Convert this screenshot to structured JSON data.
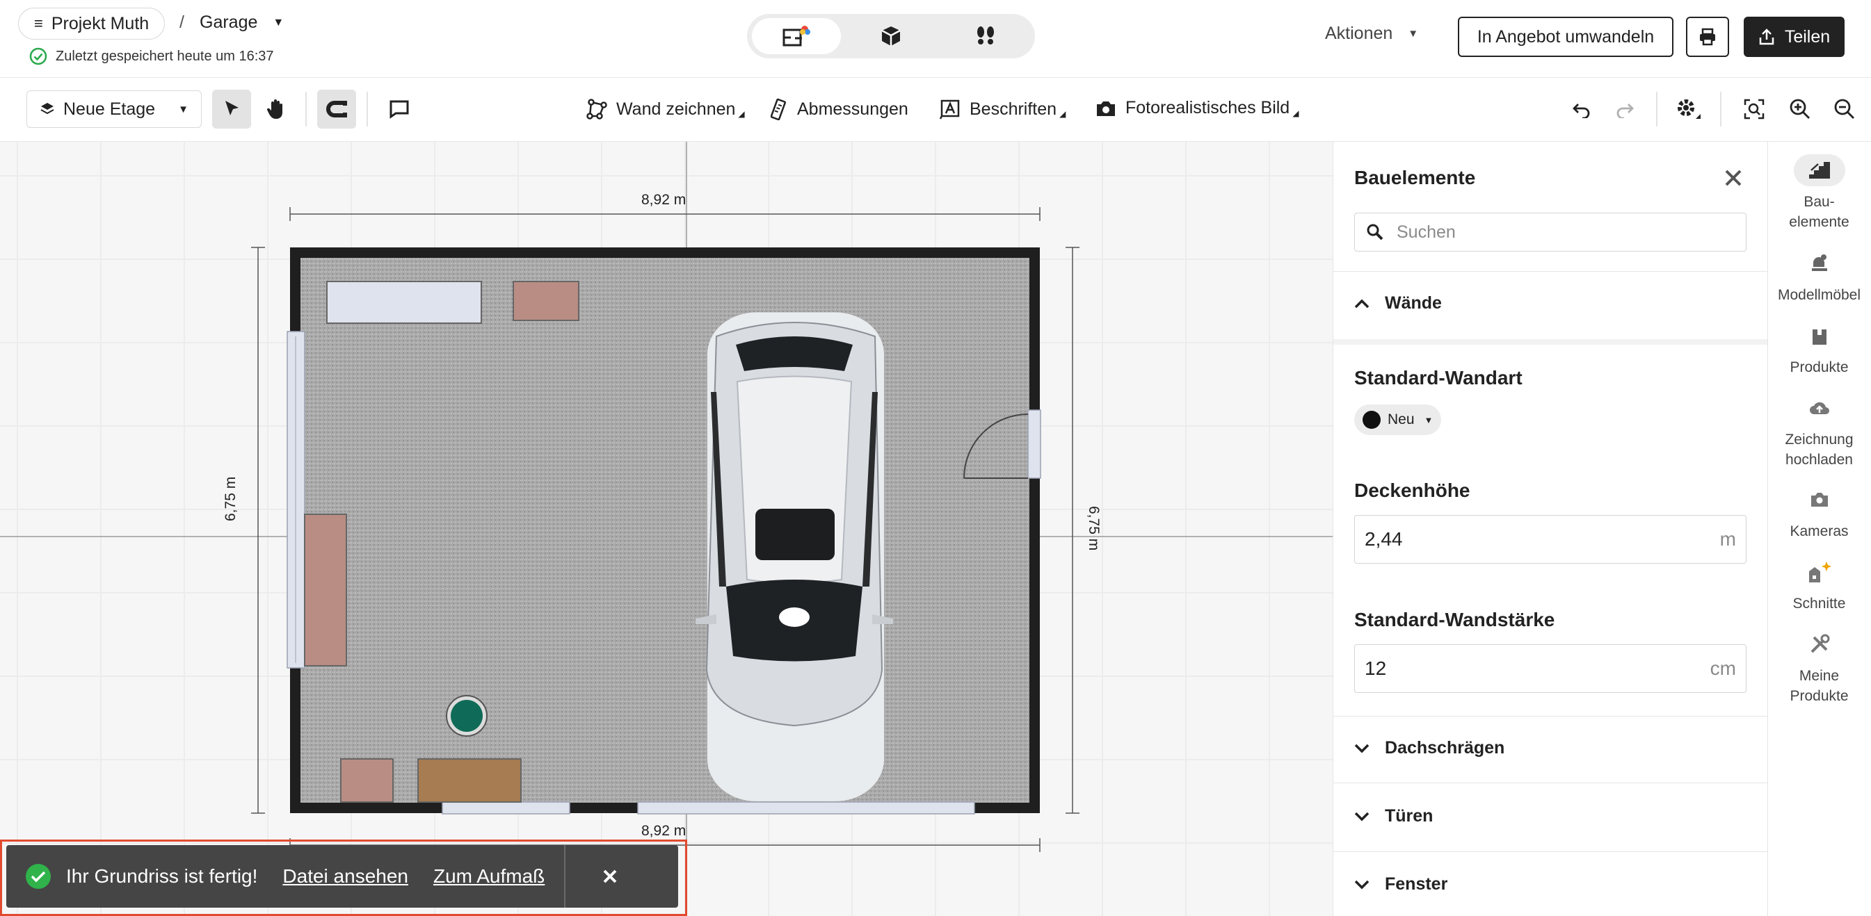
{
  "header": {
    "project_label": "Projekt Muth",
    "separator": "/",
    "room_label": "Garage",
    "saved_text": "Zuletzt gespeichert heute um 16:37",
    "actions_label": "Aktionen",
    "convert_label": "In Angebot umwandeln",
    "share_label": "Teilen",
    "view_modes": [
      "2D",
      "3D",
      "Walkthrough"
    ],
    "active_view": "2D"
  },
  "toolbar": {
    "floor_label": "Neue Etage",
    "draw_wall_label": "Wand zeichnen",
    "dimensions_label": "Abmessungen",
    "labels_label": "Beschriften",
    "photo_label": "Fotorealistisches Bild"
  },
  "canvas": {
    "dim_top": "8,92 m",
    "dim_bottom": "8,92 m",
    "dim_left": "6,75 m",
    "dim_right": "6,75 m",
    "colors": {
      "wall": "#1f1f1f",
      "floor": "#a8a8a8",
      "window": "#dfe3ee",
      "furniture_brown": "#b98d84",
      "bench": "#a77c52",
      "plant": "#0f6b57"
    }
  },
  "panel": {
    "title": "Bauelemente",
    "search_placeholder": "Suchen",
    "walls_section": "Wände",
    "wall_type_label": "Standard-Wandart",
    "wall_type_value": "Neu",
    "ceiling_label": "Deckenhöhe",
    "ceiling_value": "2,44",
    "ceiling_unit": "m",
    "thickness_label": "Standard-Wandstärke",
    "thickness_value": "12",
    "thickness_unit": "cm",
    "sections": [
      "Dachschrägen",
      "Türen",
      "Fenster"
    ]
  },
  "rail": {
    "items": [
      {
        "label": "Bau-\nelemente",
        "icon": "stairs-icon",
        "active": true
      },
      {
        "label": "Modellmöbel",
        "icon": "furniture-icon",
        "active": false
      },
      {
        "label": "Produkte",
        "icon": "house-icon",
        "active": false
      },
      {
        "label": "Zeichnung hochladen",
        "icon": "cloud-upload-icon",
        "active": false
      },
      {
        "label": "Kameras",
        "icon": "camera-icon",
        "active": false
      },
      {
        "label": "Schnitte",
        "icon": "sections-icon",
        "active": false
      },
      {
        "label": "Meine Produkte",
        "icon": "tools-icon",
        "active": false
      }
    ]
  },
  "toast": {
    "message": "Ihr Grundriss ist fertig!",
    "view_file_label": "Datei ansehen",
    "survey_label": "Zum Aufmaß"
  }
}
